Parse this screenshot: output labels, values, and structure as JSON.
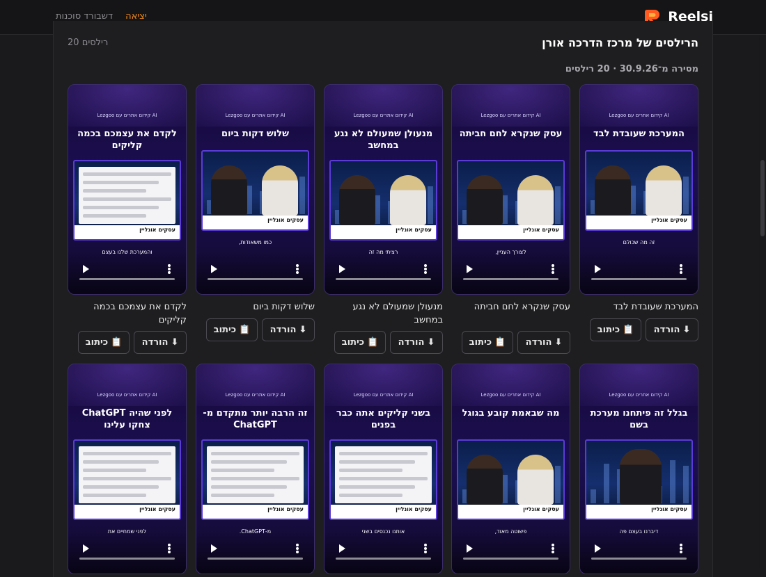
{
  "brand": {
    "name": "Reelsi",
    "logo_icon": "reelsi-logo-icon"
  },
  "nav": {
    "exit": "יציאה",
    "dashboard": "דשבורד סוכנות"
  },
  "colors": {
    "accent": "#f08a1c",
    "reel_bg": "#1b0e52",
    "frame": "#5a3bd6"
  },
  "header": {
    "title": "הרילסים של מרכז הדרכה אורן",
    "count": "20 רילסים",
    "meta": "מסירה מ־30.9.26 · 20 רילסים"
  },
  "reel_brandline": "AI קידום אתרים עם Lezgoo",
  "reel_lower_tag": "עסקים אונליין",
  "buttons": {
    "download": "הורדה",
    "copy": "כיתוב",
    "download_icon": "⬇",
    "copy_icon": "📋"
  },
  "reels": [
    {
      "headline": "המערכת שעובדת לבד",
      "caption": "זה מה שכולם",
      "title": "המערכת שעובדת לבד"
    },
    {
      "headline": "עסק שנקרא לחם חביתה",
      "caption": "לצורך העניין,",
      "title": "עסק שנקרא לחם חביתה"
    },
    {
      "headline": "מנעולן שמעולם לא נגע במחשב",
      "caption": "רציתי מה זה",
      "title": "מנעולן שמעולם לא נגע במחשב"
    },
    {
      "headline": "שלוש דקות ביום",
      "caption": "כמו משאודות,",
      "title": "שלוש דקות ביום"
    },
    {
      "headline": "לקדם את עצמכם בכמה קליקים",
      "caption": "והמערכת שלנו בעצם",
      "title": "לקדם את עצמכם בכמה קליקים"
    },
    {
      "headline": "בגלל זה פיתחנו מערכת בשם",
      "caption": "דיברנו בעצם פה"
    },
    {
      "headline": "מה שבאמת קובע בגוגל",
      "caption": "פשוטה מאוד,"
    },
    {
      "headline": "בשני קליקים אתה כבר בפנים",
      "caption": "אותנו נכנסים בשני"
    },
    {
      "headline": "זה הרבה יותר מתקדם מ-ChatGPT",
      "caption": "מ-ChatGPT."
    },
    {
      "headline": "לפני שהיה ChatGPT צחקו עלינו",
      "caption": "לפני שמחיים את"
    }
  ]
}
